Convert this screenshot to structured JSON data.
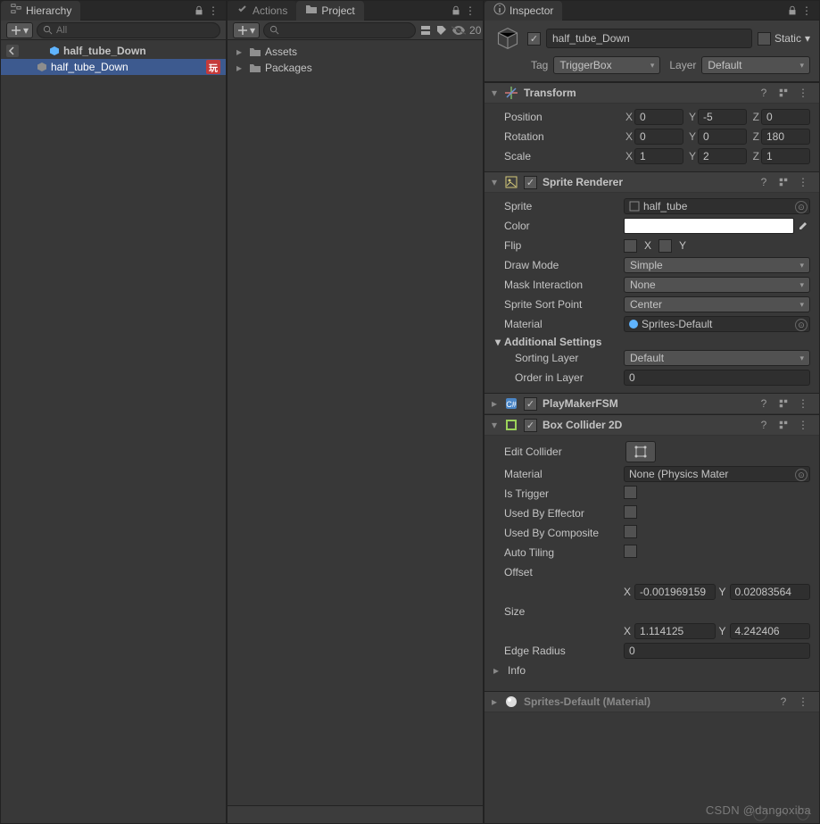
{
  "hierarchy": {
    "tab": "Hierarchy",
    "search_placeholder": "All",
    "scene_name": "half_tube_Down",
    "child_name": "half_tube_Down",
    "child_badge": "玩"
  },
  "project": {
    "tabs": {
      "actions": "Actions",
      "project": "Project"
    },
    "hidden_count": "20",
    "items": [
      "Assets",
      "Packages"
    ]
  },
  "inspector": {
    "tab": "Inspector",
    "static_label": "Static",
    "go_name": "half_tube_Down",
    "tag_label": "Tag",
    "tag_value": "TriggerBox",
    "layer_label": "Layer",
    "layer_value": "Default"
  },
  "transform": {
    "title": "Transform",
    "pos_label": "Position",
    "pos": {
      "x": "0",
      "y": "-5",
      "z": "0"
    },
    "rot_label": "Rotation",
    "rot": {
      "x": "0",
      "y": "0",
      "z": "180"
    },
    "scale_label": "Scale",
    "scale": {
      "x": "1",
      "y": "2",
      "z": "1"
    }
  },
  "sprite_renderer": {
    "title": "Sprite Renderer",
    "sprite_label": "Sprite",
    "sprite_value": "half_tube",
    "color_label": "Color",
    "flip_label": "Flip",
    "flip_x": "X",
    "flip_y": "Y",
    "drawmode_label": "Draw Mode",
    "drawmode_value": "Simple",
    "mask_label": "Mask Interaction",
    "mask_value": "None",
    "sortpoint_label": "Sprite Sort Point",
    "sortpoint_value": "Center",
    "material_label": "Material",
    "material_value": "Sprites-Default",
    "additional_title": "Additional Settings",
    "sorting_layer_label": "Sorting Layer",
    "sorting_layer_value": "Default",
    "order_label": "Order in Layer",
    "order_value": "0"
  },
  "playmaker": {
    "title": "PlayMakerFSM"
  },
  "box_collider": {
    "title": "Box Collider 2D",
    "edit_label": "Edit Collider",
    "material_label": "Material",
    "material_value": "None (Physics Mater",
    "istrigger_label": "Is Trigger",
    "usedbyeffector_label": "Used By Effector",
    "usedbycomposite_label": "Used By Composite",
    "autotiling_label": "Auto Tiling",
    "offset_label": "Offset",
    "offset": {
      "x": "-0.001969159",
      "y": "0.02083564"
    },
    "size_label": "Size",
    "size": {
      "x": "1.114125",
      "y": "4.242406"
    },
    "edgeradius_label": "Edge Radius",
    "edgeradius_value": "0",
    "info_label": "Info"
  },
  "material_footer": "Sprites-Default (Material)",
  "watermark": "CSDN @dangoxiba"
}
